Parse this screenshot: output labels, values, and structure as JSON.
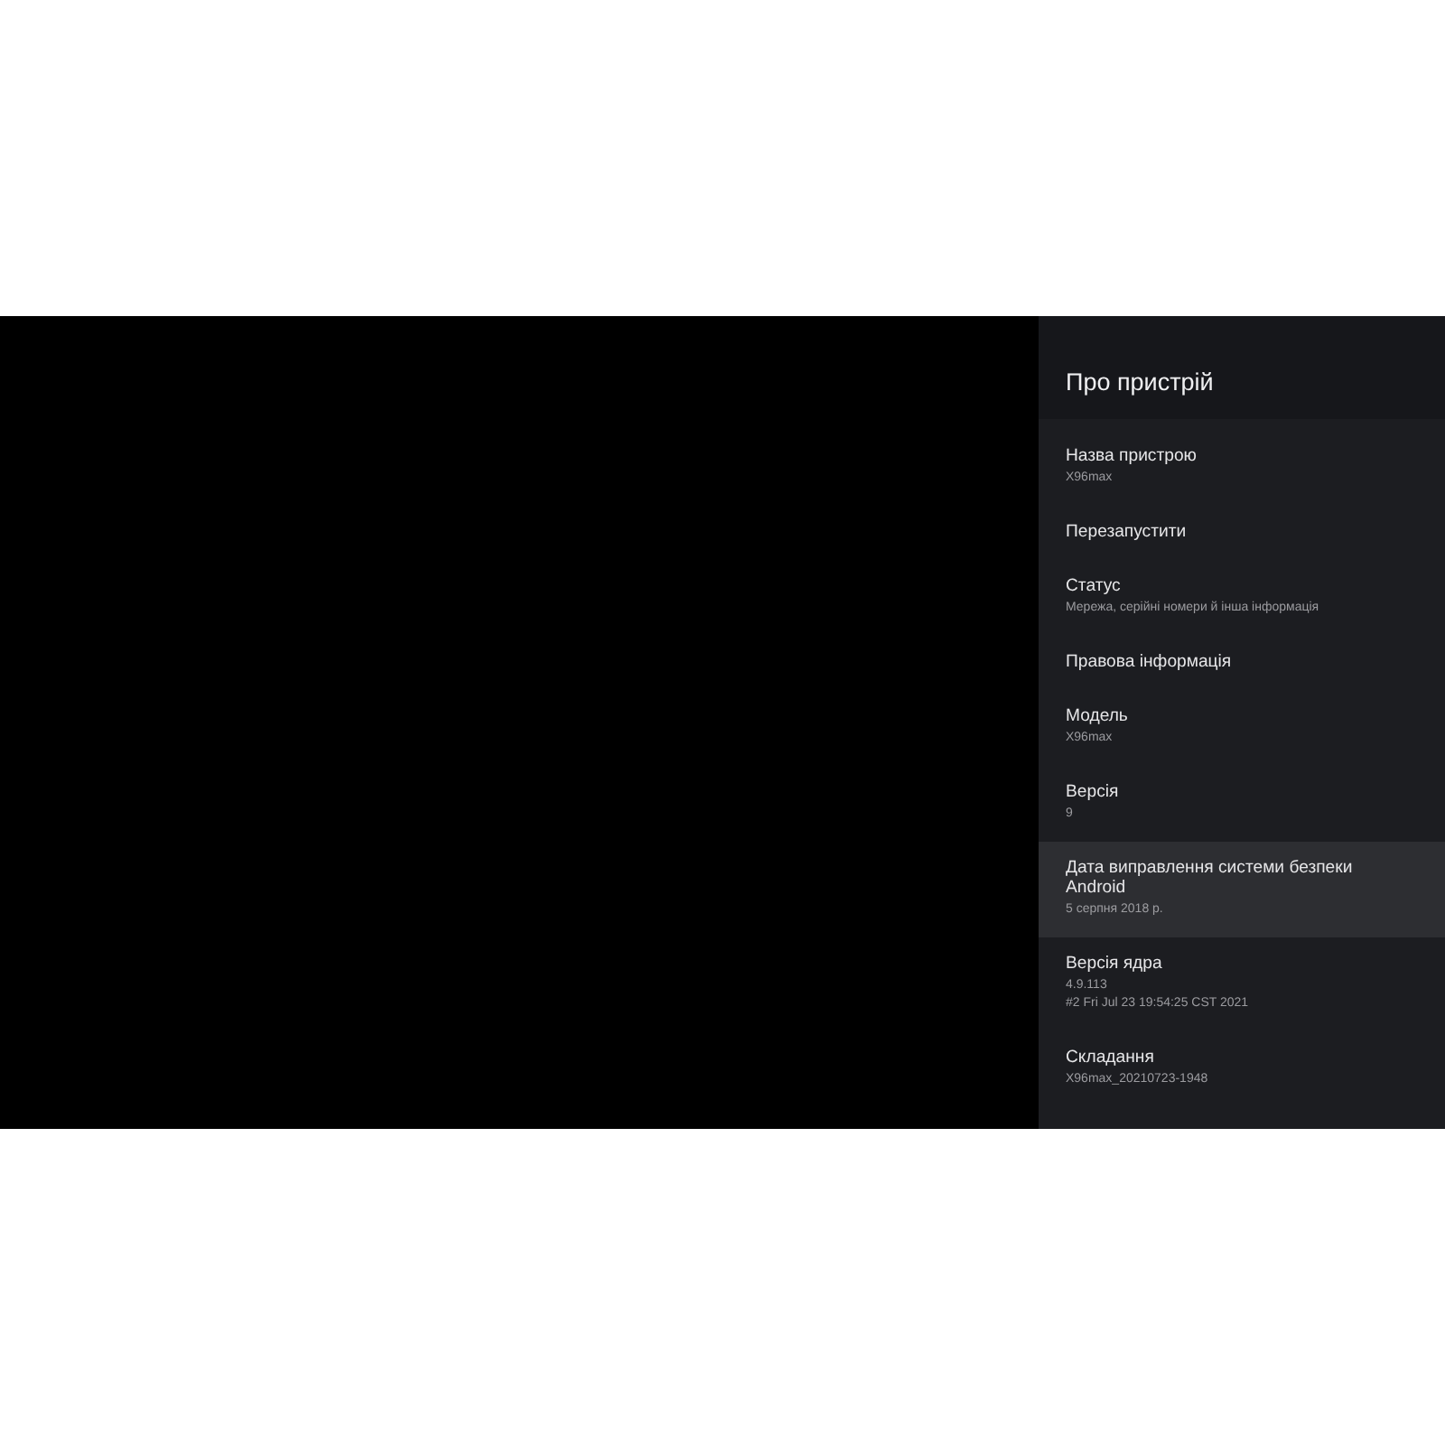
{
  "panel": {
    "title": "Про пристрій",
    "items": [
      {
        "title": "Назва пристрою",
        "summary": [
          "X96max"
        ],
        "selected": false
      },
      {
        "title": "Перезапустити",
        "selected": false
      },
      {
        "title": "Статус",
        "summary": [
          "Мережа, серійні номери й інша інформація"
        ],
        "selected": false
      },
      {
        "title": "Правова інформація",
        "selected": false
      },
      {
        "title": "Модель",
        "summary": [
          "X96max"
        ],
        "selected": false
      },
      {
        "title": "Версія",
        "summary": [
          "9"
        ],
        "selected": false
      },
      {
        "title": "Дата виправлення системи безпеки Android",
        "summary": [
          "5 серпня 2018 р."
        ],
        "selected": true
      },
      {
        "title": "Версія ядра",
        "summary": [
          "4.9.113",
          "#2 Fri Jul 23 19:54:25 CST 2021"
        ],
        "selected": false
      },
      {
        "title": "Складання",
        "summary": [
          "X96max_20210723-1948"
        ],
        "selected": false
      }
    ]
  }
}
